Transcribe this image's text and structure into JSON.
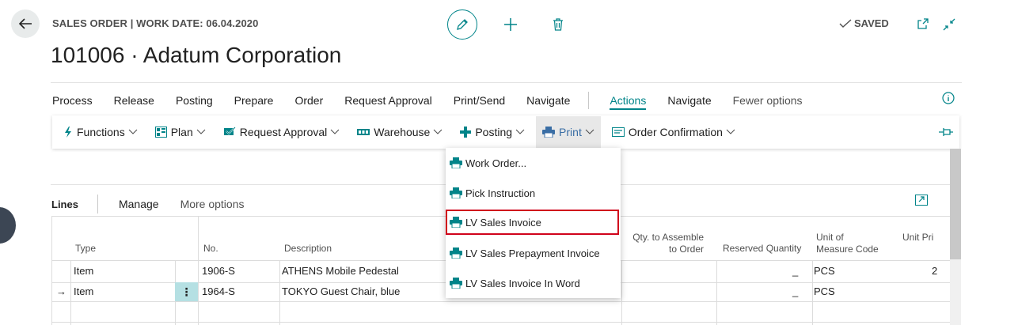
{
  "header": {
    "subtitle": "SALES ORDER | WORK DATE: 06.04.2020",
    "title": "101006 · Adatum Corporation",
    "saved_label": "SAVED"
  },
  "menu": {
    "items": [
      "Process",
      "Release",
      "Posting",
      "Prepare",
      "Order",
      "Request Approval",
      "Print/Send",
      "Navigate"
    ],
    "actions": "Actions",
    "navigate2": "Navigate",
    "fewer_options": "Fewer options"
  },
  "action_bar": {
    "functions": "Functions",
    "plan": "Plan",
    "request_approval": "Request Approval",
    "warehouse": "Warehouse",
    "posting": "Posting",
    "print": "Print",
    "order_confirmation": "Order Confirmation"
  },
  "print_menu": {
    "items": [
      "Work Order...",
      "Pick Instruction",
      "LV Sales Invoice",
      "LV Sales Prepayment Invoice",
      "LV Sales Invoice In Word"
    ],
    "highlighted_index": 2
  },
  "lines": {
    "title": "Lines",
    "manage": "Manage",
    "more_options": "More options",
    "columns": {
      "type": "Type",
      "no": "No.",
      "description": "Description",
      "qty_assemble_1": "Qty. to Assemble",
      "qty_assemble_2": "to Order",
      "reserved_quantity": "Reserved Quantity",
      "unit_measure_1": "Unit of",
      "unit_measure_2": "Measure Code",
      "unit_price": "Unit Pri"
    },
    "rows": [
      {
        "marker": "",
        "type": "Item",
        "no": "1906-S",
        "description": "ATHENS Mobile Pedestal",
        "reserved": "_",
        "uom": "PCS",
        "price": "2"
      },
      {
        "marker": "→",
        "type": "Item",
        "no": "1964-S",
        "description": "TOKYO Guest Chair, blue",
        "reserved": "_",
        "uom": "PCS",
        "price": ""
      }
    ],
    "row_menu": "⋮"
  },
  "colors": {
    "accent": "#008489",
    "highlight_border": "#d0021b",
    "selected_cell": "#b5e0e3"
  }
}
